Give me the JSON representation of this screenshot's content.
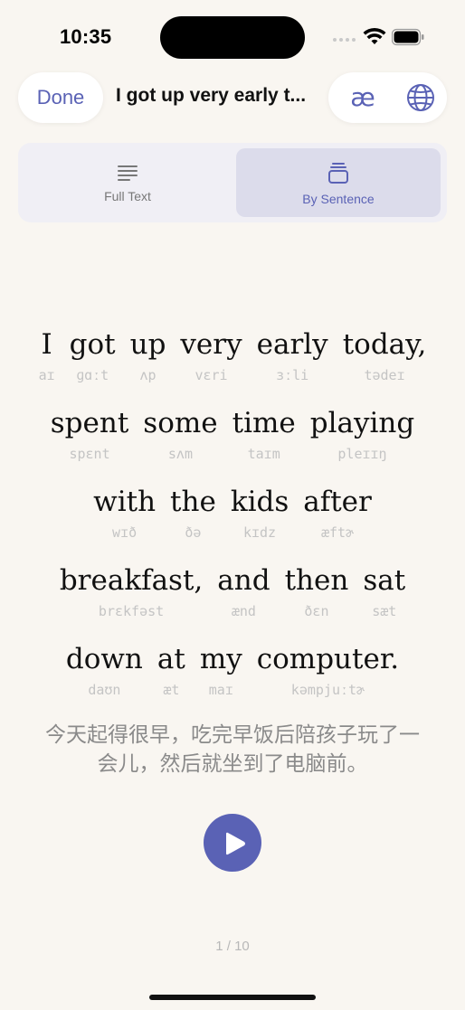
{
  "status_bar": {
    "time": "10:35",
    "icons": [
      "cellular-signal-icon",
      "wifi-icon",
      "battery-icon"
    ]
  },
  "header": {
    "done_label": "Done",
    "title": "I got up very early t...",
    "phonetic_symbol_label": "æ",
    "globe_icon": "globe-icon"
  },
  "segmented": {
    "tabs": [
      {
        "label": "Full Text",
        "icon": "text-lines-icon",
        "selected": false
      },
      {
        "label": "By Sentence",
        "icon": "stacked-cards-icon",
        "selected": true
      }
    ]
  },
  "sentence": {
    "lines": [
      [
        {
          "word": "I",
          "ipa": "aɪ"
        },
        {
          "word": "got",
          "ipa": "ɡɑːt"
        },
        {
          "word": "up",
          "ipa": "ʌp"
        },
        {
          "word": "very",
          "ipa": "vɛri"
        },
        {
          "word": "early",
          "ipa": "ɜːli"
        },
        {
          "word": "today,",
          "ipa": "tədeɪ"
        }
      ],
      [
        {
          "word": "spent",
          "ipa": "spɛnt"
        },
        {
          "word": "some",
          "ipa": "sʌm"
        },
        {
          "word": "time",
          "ipa": "taɪm"
        },
        {
          "word": "playing",
          "ipa": "pleɪɪŋ"
        }
      ],
      [
        {
          "word": "with",
          "ipa": "wɪð"
        },
        {
          "word": "the",
          "ipa": "ðə"
        },
        {
          "word": "kids",
          "ipa": "kɪdz"
        },
        {
          "word": "after",
          "ipa": "æftɚ"
        }
      ],
      [
        {
          "word": "breakfast,",
          "ipa": "brɛkfəst"
        },
        {
          "word": "and",
          "ipa": "ænd"
        },
        {
          "word": "then",
          "ipa": "ðɛn"
        },
        {
          "word": "sat",
          "ipa": "sæt"
        }
      ],
      [
        {
          "word": "down",
          "ipa": "daʊn"
        },
        {
          "word": "at",
          "ipa": "æt"
        },
        {
          "word": "my",
          "ipa": "maɪ"
        },
        {
          "word": "computer.",
          "ipa": "kəmpjuːtɚ"
        }
      ]
    ],
    "translation": "今天起得很早，吃完早饭后陪孩子玩了一会儿，然后就坐到了电脑前。"
  },
  "player": {
    "play_icon": "play-icon"
  },
  "pager": {
    "text": "1 / 10"
  },
  "colors": {
    "accent": "#5a62b5",
    "background": "#f9f6f1",
    "selected_segment": "#dcdceb"
  }
}
